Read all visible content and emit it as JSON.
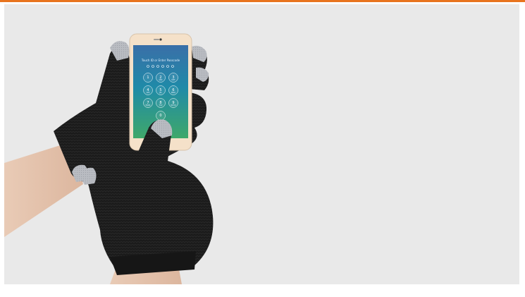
{
  "colors": {
    "accent": "#e8741e",
    "panel_background": "#e9e9e9",
    "glove": "#1b1b1b",
    "fingertip": "#b9bcc2",
    "skin": "#e7c9b4",
    "phone_body": "#f5e1c9"
  },
  "phone": {
    "passcode_title": "Touch ID or Enter Passcode",
    "keys": [
      {
        "digit": "1",
        "letters": ""
      },
      {
        "digit": "2",
        "letters": "ABC"
      },
      {
        "digit": "3",
        "letters": "DEF"
      },
      {
        "digit": "4",
        "letters": "GHI"
      },
      {
        "digit": "5",
        "letters": "JKL"
      },
      {
        "digit": "6",
        "letters": "MNO"
      },
      {
        "digit": "7",
        "letters": "PQRS"
      },
      {
        "digit": "8",
        "letters": "TUV"
      },
      {
        "digit": "9",
        "letters": "WXYZ"
      },
      {
        "digit": "0",
        "letters": ""
      }
    ]
  }
}
